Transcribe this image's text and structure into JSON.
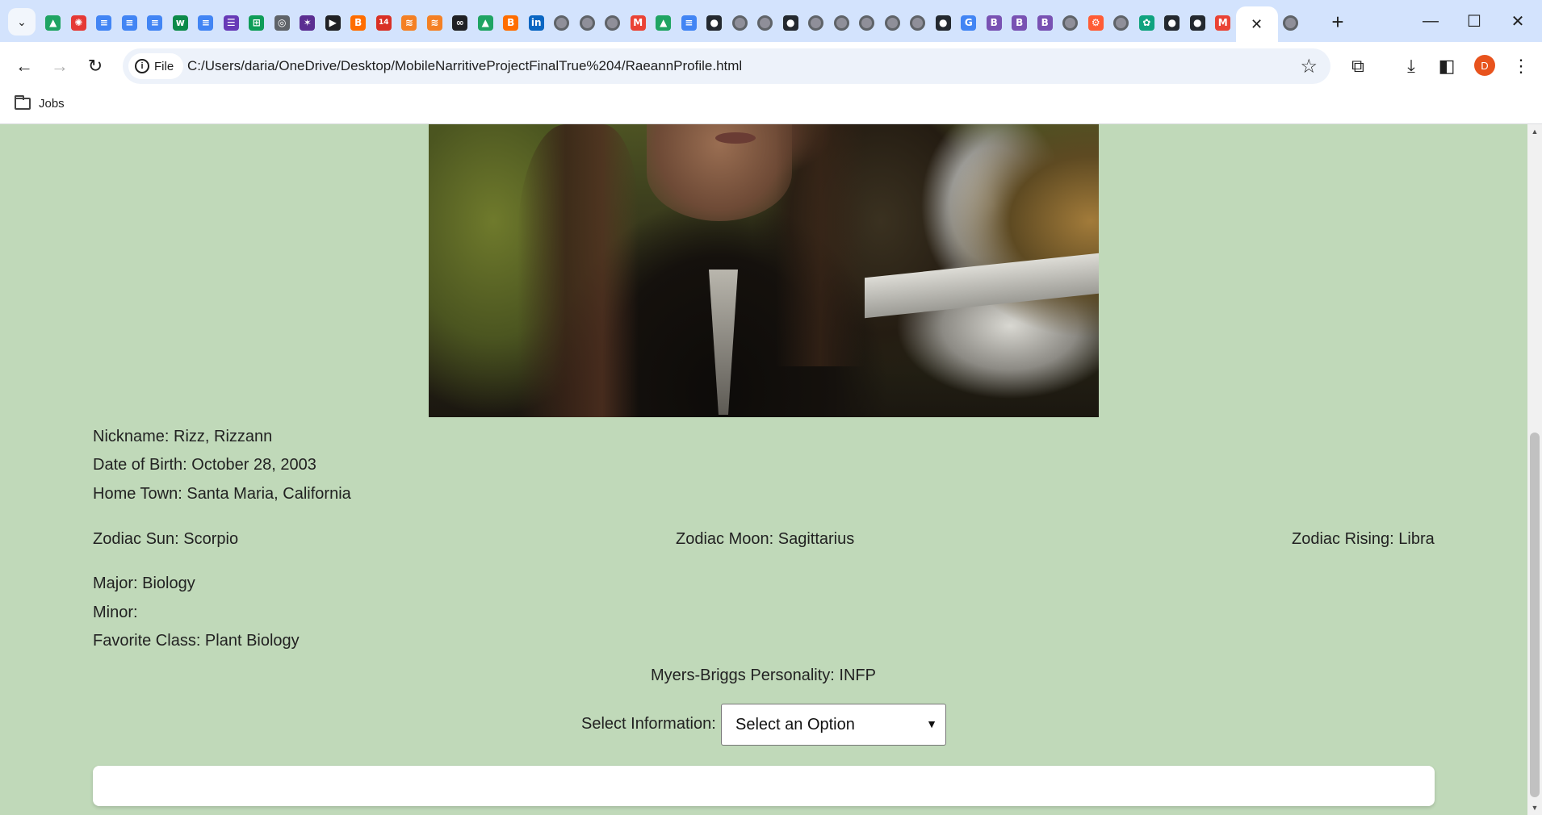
{
  "browser": {
    "tabs_favicons": [
      {
        "icon": "google-drive-icon",
        "color": "#1fa463"
      },
      {
        "icon": "pinwheel-icon",
        "color": "#e53935"
      },
      {
        "icon": "google-docs-icon",
        "color": "#4285f4"
      },
      {
        "icon": "google-docs-icon",
        "color": "#4285f4"
      },
      {
        "icon": "google-docs-icon",
        "color": "#4285f4"
      },
      {
        "icon": "wix-icon",
        "color": "#0c8a4a"
      },
      {
        "icon": "google-docs-icon",
        "color": "#4285f4"
      },
      {
        "icon": "list-icon",
        "color": "#673ab7"
      },
      {
        "icon": "google-sheets-icon",
        "color": "#0f9d58"
      },
      {
        "icon": "target-icon",
        "color": "#5f6368"
      },
      {
        "icon": "sparkle-icon",
        "color": "#5b2e91"
      },
      {
        "icon": "play-icon",
        "color": "#202124"
      },
      {
        "icon": "blogger-icon",
        "color": "#ff6d00"
      },
      {
        "icon": "calendar-icon",
        "color": "#d93025"
      },
      {
        "icon": "stack-icon",
        "color": "#f48024"
      },
      {
        "icon": "stack-icon",
        "color": "#f48024"
      },
      {
        "icon": "loop-icon",
        "color": "#202124"
      },
      {
        "icon": "google-drive-icon",
        "color": "#1fa463"
      },
      {
        "icon": "blogger-icon",
        "color": "#ff6d00"
      },
      {
        "icon": "linkedin-icon",
        "color": "#0a66c2"
      },
      {
        "icon": "globe-icon",
        "color": "#5f6368"
      },
      {
        "icon": "globe-icon",
        "color": "#5f6368"
      },
      {
        "icon": "globe-icon",
        "color": "#5f6368"
      },
      {
        "icon": "gmail-icon",
        "color": "#ea4335"
      },
      {
        "icon": "google-drive-icon",
        "color": "#1fa463"
      },
      {
        "icon": "google-docs-icon",
        "color": "#4285f4"
      },
      {
        "icon": "github-icon",
        "color": "#24292f"
      },
      {
        "icon": "globe-icon",
        "color": "#5f6368"
      },
      {
        "icon": "globe-icon",
        "color": "#5f6368"
      },
      {
        "icon": "github-icon",
        "color": "#24292f"
      },
      {
        "icon": "globe-icon",
        "color": "#5f6368"
      },
      {
        "icon": "globe-icon",
        "color": "#5f6368"
      },
      {
        "icon": "globe-icon",
        "color": "#5f6368"
      },
      {
        "icon": "globe-icon",
        "color": "#5f6368"
      },
      {
        "icon": "globe-icon",
        "color": "#5f6368"
      },
      {
        "icon": "github-icon",
        "color": "#24292f"
      },
      {
        "icon": "google-icon",
        "color": "#4285f4"
      },
      {
        "icon": "bootstrap-icon",
        "color": "#7952b3"
      },
      {
        "icon": "bootstrap-icon",
        "color": "#7952b3"
      },
      {
        "icon": "bootstrap-icon",
        "color": "#7952b3"
      },
      {
        "icon": "globe-icon",
        "color": "#5f6368"
      },
      {
        "icon": "hubspot-icon",
        "color": "#ff5c35"
      },
      {
        "icon": "globe-icon",
        "color": "#5f6368"
      },
      {
        "icon": "openai-icon",
        "color": "#10a37f"
      },
      {
        "icon": "github-icon",
        "color": "#24292f"
      },
      {
        "icon": "github-icon",
        "color": "#24292f"
      },
      {
        "icon": "gmail-icon",
        "color": "#ea4335"
      }
    ],
    "address": {
      "scheme_chip": "File",
      "url": "C:/Users/daria/OneDrive/Desktop/MobileNarritiveProjectFinalTrue%204/RaeannProfile.html"
    },
    "profile_initial": "D",
    "bookmarks": [
      {
        "label": "Jobs",
        "icon": "folder-icon"
      }
    ]
  },
  "profile": {
    "nickname": "Nickname: Rizz, Rizzann",
    "dob": "Date of Birth: October 28, 2003",
    "hometown": "Home Town: Santa Maria, California",
    "zodiac_sun": "Zodiac Sun: Scorpio",
    "zodiac_moon": "Zodiac Moon: Sagittarius",
    "zodiac_rising": "Zodiac Rising: Libra",
    "major": "Major: Biology",
    "minor": "Minor:",
    "favorite_class": "Favorite Class: Plant Biology",
    "mbti": "Myers-Briggs Personality: INFP"
  },
  "selector": {
    "label": "Select Information:",
    "selected": "Select an Option"
  },
  "colors": {
    "page_background": "#c0d9b9",
    "tabstrip": "#d3e3fd",
    "profile_avatar": "#e8531d"
  }
}
